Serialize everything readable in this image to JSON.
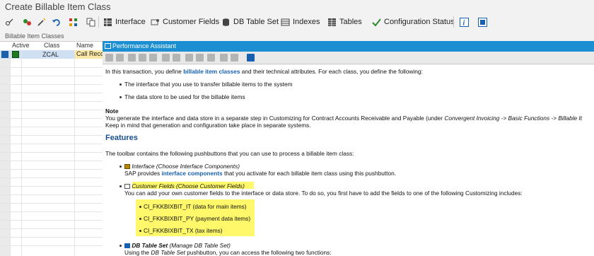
{
  "title": "Create Billable Item Class",
  "toolbar": {
    "interface": "Interface",
    "customer_fields": "Customer Fields",
    "db_table_set": "DB Table Set",
    "indexes": "Indexes",
    "tables": "Tables",
    "config_status": "Configuration Status"
  },
  "left_panel": {
    "title": "Billable Item Classes",
    "columns": [
      "Active",
      "Class",
      "Name"
    ],
    "row": {
      "class": "ZCAL",
      "name": "Call Record"
    }
  },
  "assistant": {
    "title": "Performance Assistant",
    "intro_a": "In this transaction, you define ",
    "intro_link": "billable item classes",
    "intro_b": " and their technical attributes. For each class, you define the following:",
    "bullet1": "The interface that you use to transfer billable items to the system",
    "bullet2": "The data store to be used for the billable items",
    "note_label": "Note",
    "note_a": "You generate the interface and data store in a separate step in Customizing for Contract Accounts Receivable and Payable (under ",
    "note_path": "Convergent Invoicing -> Basic Functions -> Billable It",
    "note_b": "Keep in mind that generation and configuration take place in separate systems.",
    "features_heading": "Features",
    "features_text": "The toolbar contains the following pushbuttons that you can use to process a billable item class:",
    "f1_title": "Interface",
    "f1_title_paren": " (Choose Interface Components)",
    "f1_text_a": "SAP provides ",
    "f1_link": "interface components",
    "f1_text_b": " that you activate for each billable item class using this pushbutton.",
    "f2_title": "Customer Fields (Choose Customer Fields)",
    "f2_text": "You can add your own customer fields to the interface or data store. To do so, you first have to add the fields to one of the following Customizing includes:",
    "includes": [
      "CI_FKKBIXBIT_IT (data for main items)",
      "CI_FKKBIXBIT_PY (payment data items)",
      "CI_FKKBIXBIT_TX (tax items)"
    ],
    "f3_title": "DB Table Set",
    "f3_title_paren": " (Manage DB Table Set)",
    "f3_text_a": "Using the ",
    "f3_text_it": "DB Table Set",
    "f3_text_b": " pushbutton, you can access the following two functions:"
  },
  "colors": {
    "header_blue": "#1c8fd2",
    "highlight": "#fff86a",
    "link": "#1760b0"
  }
}
